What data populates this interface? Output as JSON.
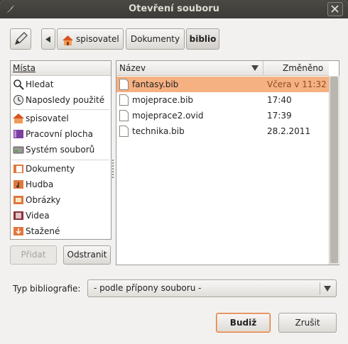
{
  "window": {
    "title": "Otevření souboru"
  },
  "breadcrumb": {
    "items": [
      "spisovatel",
      "Dokumenty",
      "biblio"
    ]
  },
  "places": {
    "header": "Místa",
    "items": [
      {
        "label": "Hledat",
        "icon": "search-icon"
      },
      {
        "label": "Naposledy použité",
        "icon": "clock-icon"
      },
      {
        "label": "spisovatel",
        "icon": "home-folder-icon"
      },
      {
        "label": "Pracovní plocha",
        "icon": "desktop-icon"
      },
      {
        "label": "Systém souborů",
        "icon": "drive-icon"
      },
      {
        "label": "Dokumenty",
        "icon": "documents-folder-icon"
      },
      {
        "label": "Hudba",
        "icon": "music-folder-icon"
      },
      {
        "label": "Obrázky",
        "icon": "pictures-folder-icon"
      },
      {
        "label": "Videa",
        "icon": "videos-folder-icon"
      },
      {
        "label": "Stažené",
        "icon": "downloads-folder-icon"
      }
    ]
  },
  "buttons": {
    "add": "Přidat",
    "remove": "Odstranit",
    "ok": "Budiž",
    "cancel": "Zrušit"
  },
  "files": {
    "columns": {
      "name": "Název",
      "modified": "Změněno"
    },
    "rows": [
      {
        "name": "fantasy.bib",
        "modified": "Včera v 11:32",
        "selected": true
      },
      {
        "name": "mojeprace.bib",
        "modified": "17:40"
      },
      {
        "name": "mojeprace2.ovid",
        "modified": "17:39"
      },
      {
        "name": "technika.bib",
        "modified": "28.2.2011"
      }
    ]
  },
  "filter": {
    "label": "Typ bibliografie:",
    "value": "- podle přípony souboru -"
  },
  "colors": {
    "selection": "#f6b183",
    "titlebar": "#3c3b37",
    "default_button_border": "#e07a3f"
  }
}
